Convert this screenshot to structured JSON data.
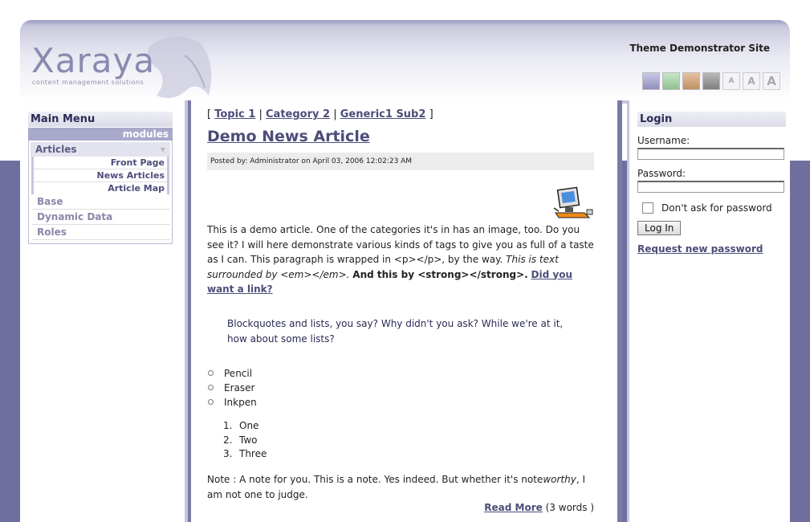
{
  "header": {
    "logo_text": "Xaraya",
    "logo_tagline": "content management solutions",
    "site_title": "Theme Demonstrator Site",
    "theme_colors": [
      "#a5a5cf",
      "#a6cfa6",
      "#cf9f7a",
      "#999999"
    ],
    "font_size_buttons": [
      "A",
      "A",
      "A"
    ]
  },
  "left": {
    "menu_title": "Main Menu",
    "modules_label": "modules",
    "active_module": "Articles",
    "sub_items": [
      "Front Page",
      "News Articles",
      "Article Map"
    ],
    "modules": [
      "Base",
      "Dynamic Data",
      "Roles"
    ]
  },
  "article": {
    "crumb_open": "[",
    "crumb_close": "]",
    "crumbs": [
      "Topic 1",
      "Category 2",
      "Generic1 Sub2"
    ],
    "crumb_sep": "|",
    "title": "Demo News Article",
    "posted": "Posted by: Administrator on April 03, 2006 12:02:23 AM",
    "para1_text": "This is a demo article. One of the categories it's in has an image, too. Do you see it? I will here demonstrate various kinds of tags to give you as full of a taste as I can. This paragraph is wrapped in <p></p>, by the way.",
    "para1_em": "This is text surrounded by <em></em>.",
    "para1_strong": "And this by <strong></strong>.",
    "para1_link": "Did you want a link?",
    "blockquote": "Blockquotes and lists, you say? Why didn't you ask? While we're at it, how about some lists?",
    "bullets": [
      "Pencil",
      "Eraser",
      "Inkpen"
    ],
    "numbered": [
      "One",
      "Two",
      "Three"
    ],
    "numbered_labels": [
      "1.",
      "2.",
      "3."
    ],
    "note_a": "Note : A note for you. This is a note. Yes indeed. But whether it's note",
    "note_em": "worthy",
    "note_b": ", I am not one to judge.",
    "read_more": "Read More",
    "word_count": "(3  words )"
  },
  "login": {
    "title": "Login",
    "username_label": "Username:",
    "password_label": "Password:",
    "remember_label": "Don't ask for password",
    "button_label": "Log In",
    "request_link": "Request new password"
  }
}
